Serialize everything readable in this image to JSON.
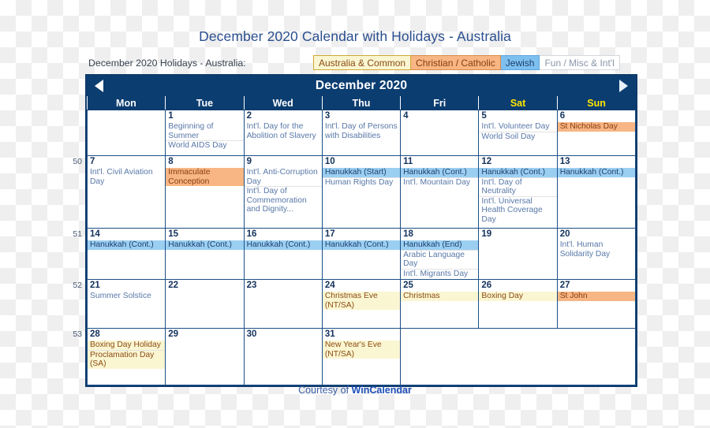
{
  "title": "December 2020 Calendar with Holidays - Australia",
  "legend": {
    "caption": "December 2020 Holidays - Australia:",
    "chips": [
      {
        "label": "Australia & Common",
        "key": "common",
        "bg": "#fbf6d2",
        "fg": "#8a4b12"
      },
      {
        "label": "Christian / Catholic",
        "key": "christian",
        "bg": "#f7b683",
        "fg": "#8a3c10"
      },
      {
        "label": "Jewish",
        "key": "jewish",
        "bg": "#7dc0f0",
        "fg": "#1d3f6e"
      },
      {
        "label": "Fun / Misc & Int'l",
        "key": "fun",
        "bg": "#ffffff",
        "fg": "#8896a8"
      }
    ]
  },
  "calendar": {
    "month_label": "December 2020",
    "prev_label": "◀",
    "next_label": "▶",
    "weekday_headers": [
      "Mon",
      "Tue",
      "Wed",
      "Thu",
      "Fri",
      "Sat",
      "Sun"
    ],
    "week_numbers": [
      "50",
      "51",
      "52",
      "53"
    ],
    "watermark": "WinCalendar",
    "weeks": [
      {
        "week_number": "",
        "days": [
          {
            "num": "",
            "blank": true,
            "events": []
          },
          {
            "num": "1",
            "events": [
              {
                "text": "Beginning of Summer",
                "type": "fun"
              },
              {
                "text": "World AIDS Day",
                "type": "fun"
              }
            ]
          },
          {
            "num": "2",
            "events": [
              {
                "text": "Int'l. Day for the Abolition of Slavery",
                "type": "fun"
              }
            ]
          },
          {
            "num": "3",
            "events": [
              {
                "text": "Int'l. Day of Persons with Disabilities",
                "type": "fun"
              }
            ]
          },
          {
            "num": "4",
            "events": []
          },
          {
            "num": "5",
            "weekend": true,
            "events": [
              {
                "text": "Int'l. Volunteer Day",
                "type": "fun"
              },
              {
                "text": "World Soil Day",
                "type": "fun"
              }
            ]
          },
          {
            "num": "6",
            "weekend": true,
            "events": [
              {
                "text": "St Nicholas Day",
                "type": "christian"
              }
            ]
          }
        ]
      },
      {
        "week_number": "50",
        "days": [
          {
            "num": "7",
            "events": [
              {
                "text": "Int'l. Civil Aviation Day",
                "type": "fun"
              }
            ]
          },
          {
            "num": "8",
            "events": [
              {
                "text": "Immaculate Conception",
                "type": "christian"
              }
            ]
          },
          {
            "num": "9",
            "events": [
              {
                "text": "Int'l. Anti-Corruption Day",
                "type": "fun"
              },
              {
                "text": "Int'l. Day of Commemoration and Dignity...",
                "type": "fun"
              }
            ]
          },
          {
            "num": "10",
            "events": [
              {
                "text": "Hanukkah (Start)",
                "type": "jewish"
              },
              {
                "text": "Human Rights Day",
                "type": "fun"
              }
            ]
          },
          {
            "num": "11",
            "events": [
              {
                "text": "Hanukkah (Cont.)",
                "type": "jewish"
              },
              {
                "text": "Int'l. Mountain Day",
                "type": "fun"
              }
            ]
          },
          {
            "num": "12",
            "weekend": true,
            "events": [
              {
                "text": "Hanukkah (Cont.)",
                "type": "jewish"
              },
              {
                "text": "Int'l. Day of Neutrality",
                "type": "fun"
              },
              {
                "text": "Int'l. Universal Health Coverage Day",
                "type": "fun"
              }
            ]
          },
          {
            "num": "13",
            "weekend": true,
            "events": [
              {
                "text": "Hanukkah (Cont.)",
                "type": "jewish"
              }
            ]
          }
        ]
      },
      {
        "week_number": "51",
        "days": [
          {
            "num": "14",
            "events": [
              {
                "text": "Hanukkah (Cont.)",
                "type": "jewish"
              }
            ]
          },
          {
            "num": "15",
            "events": [
              {
                "text": "Hanukkah (Cont.)",
                "type": "jewish"
              }
            ]
          },
          {
            "num": "16",
            "events": [
              {
                "text": "Hanukkah (Cont.)",
                "type": "jewish"
              }
            ]
          },
          {
            "num": "17",
            "events": [
              {
                "text": "Hanukkah (Cont.)",
                "type": "jewish"
              }
            ]
          },
          {
            "num": "18",
            "events": [
              {
                "text": "Hanukkah (End)",
                "type": "jewish"
              },
              {
                "text": "Arabic Language Day",
                "type": "fun"
              },
              {
                "text": "Int'l. Migrants Day",
                "type": "fun"
              }
            ]
          },
          {
            "num": "19",
            "weekend": true,
            "events": []
          },
          {
            "num": "20",
            "weekend": true,
            "events": [
              {
                "text": "Int'l. Human Solidarity Day",
                "type": "fun"
              }
            ]
          }
        ]
      },
      {
        "week_number": "52",
        "days": [
          {
            "num": "21",
            "events": [
              {
                "text": "Summer Solstice",
                "type": "fun"
              }
            ]
          },
          {
            "num": "22",
            "events": []
          },
          {
            "num": "23",
            "events": []
          },
          {
            "num": "24",
            "events": [
              {
                "text": "Christmas Eve (NT/SA)",
                "type": "common"
              }
            ]
          },
          {
            "num": "25",
            "events": [
              {
                "text": "Christmas",
                "type": "common"
              }
            ]
          },
          {
            "num": "26",
            "weekend": true,
            "events": [
              {
                "text": "Boxing Day",
                "type": "common"
              }
            ]
          },
          {
            "num": "27",
            "weekend": true,
            "events": [
              {
                "text": "St John",
                "type": "christian"
              }
            ]
          }
        ]
      },
      {
        "week_number": "53",
        "days": [
          {
            "num": "28",
            "events": [
              {
                "text": "Boxing Day Holiday",
                "type": "common"
              },
              {
                "text": "Proclamation Day (SA)",
                "type": "common"
              }
            ]
          },
          {
            "num": "29",
            "events": []
          },
          {
            "num": "30",
            "events": []
          },
          {
            "num": "31",
            "events": [
              {
                "text": "New Year's Eve (NT/SA)",
                "type": "common"
              }
            ]
          },
          {
            "num": "",
            "merged_grey": true,
            "events": []
          }
        ]
      }
    ]
  },
  "footer": {
    "prefix": "Courtesy of ",
    "brand": "WinCalendar"
  }
}
